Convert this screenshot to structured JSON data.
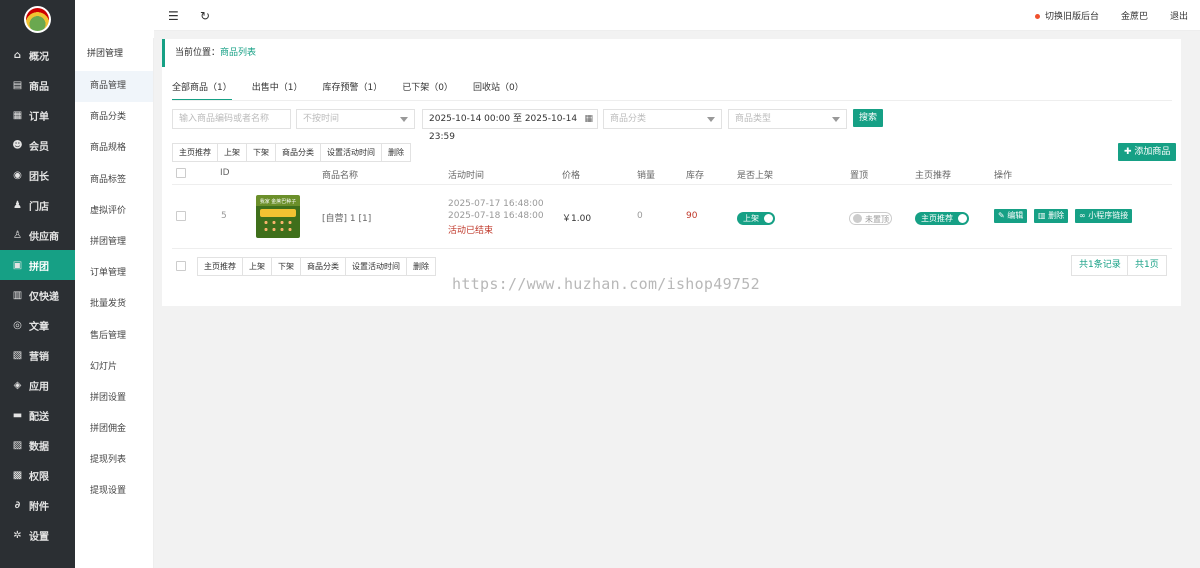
{
  "sidebar": {
    "items": [
      {
        "label": "概况",
        "icon": "home-icon",
        "glyph": "⌂"
      },
      {
        "label": "商品",
        "icon": "goods-icon",
        "glyph": "▤"
      },
      {
        "label": "订单",
        "icon": "order-icon",
        "glyph": "▦"
      },
      {
        "label": "会员",
        "icon": "users-icon",
        "glyph": "☻"
      },
      {
        "label": "团长",
        "icon": "leader-icon",
        "glyph": "◉"
      },
      {
        "label": "门店",
        "icon": "store-icon",
        "glyph": "♟"
      },
      {
        "label": "供应商",
        "icon": "supplier-icon",
        "glyph": "♙"
      },
      {
        "label": "拼团",
        "icon": "group-icon",
        "glyph": "▣"
      },
      {
        "label": "仅快递",
        "icon": "express-icon",
        "glyph": "▥"
      },
      {
        "label": "文章",
        "icon": "article-icon",
        "glyph": "◎"
      },
      {
        "label": "营销",
        "icon": "marketing-icon",
        "glyph": "▧"
      },
      {
        "label": "应用",
        "icon": "apps-icon",
        "glyph": "◈"
      },
      {
        "label": "配送",
        "icon": "delivery-icon",
        "glyph": "▬"
      },
      {
        "label": "数据",
        "icon": "data-icon",
        "glyph": "▨"
      },
      {
        "label": "权限",
        "icon": "lock-icon",
        "glyph": "▩"
      },
      {
        "label": "附件",
        "icon": "attachment-icon",
        "glyph": "∂"
      },
      {
        "label": "设置",
        "icon": "gear-icon",
        "glyph": "✲"
      }
    ],
    "active_index": 7
  },
  "subsidebar": {
    "title": "拼团管理",
    "items": [
      "商品管理",
      "商品分类",
      "商品规格",
      "商品标签",
      "虚拟评价",
      "拼团管理",
      "订单管理",
      "批量发货",
      "售后管理",
      "幻灯片",
      "拼团设置",
      "拼团佣金",
      "提现列表",
      "提现设置"
    ]
  },
  "topbar": {
    "switch_old": "切换旧版后台",
    "user": "金蔗巴",
    "logout": "退出"
  },
  "breadcrumb": {
    "prefix": "当前位置：",
    "current": "商品列表"
  },
  "tabs": [
    "全部商品（1）",
    "出售中（1）",
    "库存预警（1）",
    "已下架（0）",
    "回收站（0）"
  ],
  "filters": {
    "keyword_placeholder": "输入商品编码或者名称",
    "time_select": "不按时间",
    "date_range": "2025-10-14 00:00 至 2025-10-14 23:59",
    "category": "商品分类",
    "type": "商品类型",
    "search_label": "搜索"
  },
  "batch_actions": [
    "主页推荐",
    "上架",
    "下架",
    "商品分类",
    "设置活动时间",
    "删除"
  ],
  "add_button": "添加商品",
  "table": {
    "headers": [
      "ID",
      "商品名称",
      "活动时间",
      "价格",
      "销量",
      "库存",
      "是否上架",
      "置顶",
      "主页推荐",
      "操作"
    ],
    "rows": [
      {
        "id": "5",
        "image_caption": "我家 金蔗巴种子",
        "name": "[自营] 1 [1]",
        "start": "2025-07-17 16:48:00",
        "end": "2025-07-18 16:48:00",
        "status": "活动已结束",
        "price": "￥1.00",
        "sales": "0",
        "stock": "90",
        "on_shelf": "上架",
        "top": "未置顶",
        "recommend": "主页推荐",
        "ops": [
          "编辑",
          "删除",
          "小程序链接"
        ]
      }
    ]
  },
  "pager": {
    "total_records": "共1条记录",
    "total_pages": "共1页"
  },
  "watermark": "https://www.huzhan.com/ishop49752",
  "colors": {
    "accent": "#16a085",
    "sidebar_bg": "#2b2f33",
    "stock_red": "#c0392b",
    "status_red": "#c0392b"
  }
}
